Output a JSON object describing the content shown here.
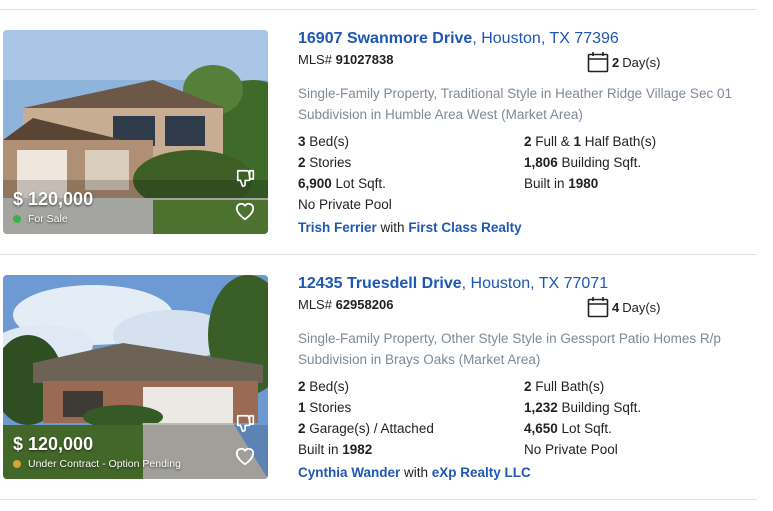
{
  "listings": [
    {
      "street": "16907 Swanmore Drive",
      "city_state_zip": ", Houston, TX 77396",
      "mls_label": "MLS#",
      "mls_number": "91027838",
      "days_number": "2",
      "days_label": "Day(s)",
      "description": "Single-Family Property, Traditional Style in Heather Ridge Village Sec 01 Subdivision in Humble Area West (Market Area)",
      "price": "$ 120,000",
      "status": "For Sale",
      "status_color": "#3cb14a",
      "details": [
        {
          "num": "3",
          "text": " Bed(s)"
        },
        {
          "num": "2",
          "text": " Full & ",
          "num2": "1",
          "text2": " Half Bath(s)"
        },
        {
          "num": "2",
          "text": " Stories"
        },
        {
          "num": "1,806",
          "text": " Building Sqft."
        },
        {
          "num": "6,900",
          "text": " Lot Sqft."
        },
        {
          "pre": "Built in ",
          "num": "1980"
        },
        {
          "text": "No Private Pool"
        }
      ],
      "agent_name": "Trish Ferrier",
      "agent_with": " with ",
      "agency": "First Class Realty"
    },
    {
      "street": "12435 Truesdell Drive",
      "city_state_zip": ", Houston, TX 77071",
      "mls_label": "MLS#",
      "mls_number": "62958206",
      "days_number": "4",
      "days_label": "Day(s)",
      "description": "Single-Family Property, Other Style Style in Gessport Patio Homes R/p Subdivision in Brays Oaks (Market Area)",
      "price": "$ 120,000",
      "status": "Under Contract - Option Pending",
      "status_color": "#d6a437",
      "details": [
        {
          "num": "2",
          "text": " Bed(s)"
        },
        {
          "num": "2",
          "text": " Full Bath(s)"
        },
        {
          "num": "1",
          "text": " Stories"
        },
        {
          "num": "1,232",
          "text": " Building Sqft."
        },
        {
          "num": "2",
          "text": " Garage(s) / Attached"
        },
        {
          "num": "4,650",
          "text": " Lot Sqft."
        },
        {
          "pre": "Built in ",
          "num": "1982"
        },
        {
          "text": "No Private Pool"
        }
      ],
      "agent_name": "Cynthia Wander",
      "agent_with": " with ",
      "agency": "eXp Realty LLC"
    }
  ]
}
